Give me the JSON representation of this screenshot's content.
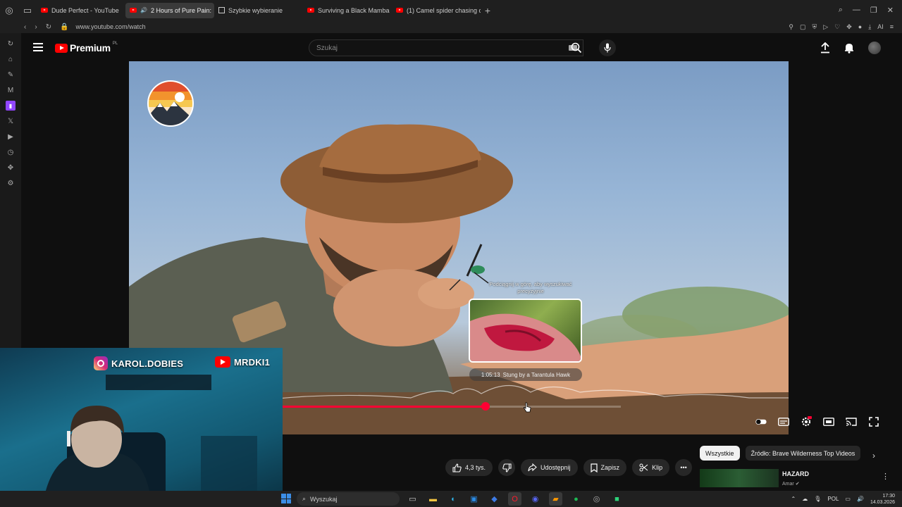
{
  "browser": {
    "tabs": [
      {
        "label": "Dude Perfect - YouTube",
        "favicon": "youtube",
        "active": false
      },
      {
        "label": "2 Hours of Pure Pain:",
        "favicon": "youtube",
        "active": true
      },
      {
        "label": "Szybkie wybieranie",
        "favicon": "grid",
        "active": false
      },
      {
        "label": "Surviving a Black Mamba",
        "favicon": "youtube",
        "active": false
      },
      {
        "label": "(1) Camel spider chasing o",
        "favicon": "youtube",
        "active": false
      }
    ],
    "new_tab_label": "+",
    "url": "www.youtube.com/watch"
  },
  "youtube": {
    "logo_text": "Premium",
    "logo_region": "PL",
    "search_placeholder": "Szukaj"
  },
  "player": {
    "hover_hint": "Podciągnij w górę, aby wyszukiwać precyzyjnie",
    "chapter_time": "1:05:13",
    "chapter_title": "Stung by a Tarantula Hawk",
    "progress_fraction": 0.6,
    "accent_color": "#ff0033"
  },
  "webcam": {
    "instagram_handle": "KAROL.DOBIES",
    "youtube_handle": "MRDKI1"
  },
  "actions": {
    "likes": "4,3 tys.",
    "share": "Udostępnij",
    "save": "Zapisz",
    "clip": "Klip",
    "more": "•••"
  },
  "filter_chips": [
    "Wszystkie",
    "Źródło: Brave Wilderness Top Videos"
  ],
  "recommendation": {
    "title": "HAZARD",
    "channel": "Amar"
  },
  "taskbar": {
    "search_label": "Wyszukaj",
    "language": "POL",
    "time": "17:30",
    "date": "14.03.2026"
  }
}
